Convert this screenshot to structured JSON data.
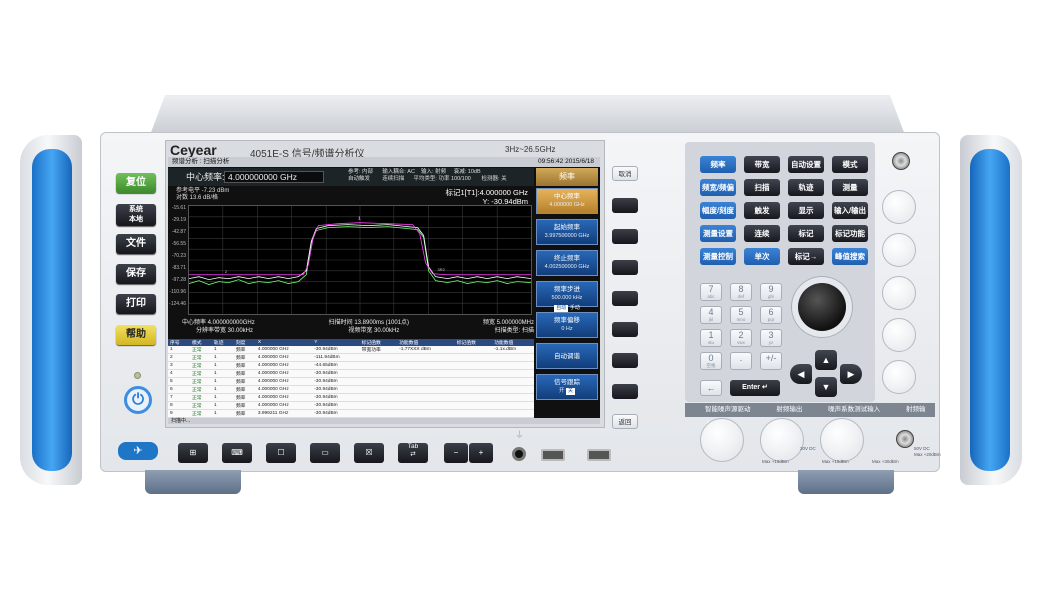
{
  "instrument": {
    "brand": "Ceyear",
    "model_title": "4051E-S 信号/频谱分析仪",
    "freq_range": "3Hz~26.5GHz"
  },
  "screen": {
    "status_bar": "频谱分析 : 扫描分析",
    "status_time": "09:56:42  2015/6/18",
    "center_label": "中心频率:",
    "center_value": "4.000000000 GHz",
    "center_params": "参考: 内部      输入耦合: AC    输入: 射频     衰减: 10dB\n自动触发        连续扫描      平均类型: 功率 100/100       检测器: 关",
    "ref_level": "参考电平 -7.23 dBm",
    "scale": "对数 13.6 dB/格",
    "marker_label": "标记1[T1]:4.000000 GHz",
    "marker_value": "Y: -30.94dBm",
    "y_ticks": [
      "-15.61",
      "-29.19",
      "-42.87",
      "-56.55",
      "-70.23",
      "-83.71",
      "-97.28",
      "-110.96",
      "-124.46"
    ],
    "center_freq_footer": "中心频率 4.000000000GHz",
    "sweep_time": "扫描时间 13.8900ms (1001点)",
    "span": "频宽 5.000000MHz",
    "rbw": "分辨率带宽 30.00kHz",
    "vbw": "视频带宽 30.00kHz",
    "sweep_type": "扫描类型: 扫描",
    "bottom_status": "扫描中..."
  },
  "table": {
    "headers": [
      "序号",
      "模式",
      "轨迹",
      "刻度",
      "X",
      "Y",
      "标记函数",
      "功能数值",
      "标记函数",
      "功能数值"
    ],
    "rows": [
      [
        "1",
        "正常",
        "1",
        "频率",
        "4.000000 GHz",
        "-30.94dBm",
        "带宽功率",
        "-1.77XXX dBm",
        "",
        "-1.1x.dBm"
      ],
      [
        "2",
        "正常",
        "1",
        "频率",
        "4.000000 GHz",
        "-111.94dBm",
        "",
        "",
        "",
        ""
      ],
      [
        "3",
        "正常",
        "1",
        "频率",
        "4.000000 GHz",
        "-44.65dBm",
        "",
        "",
        "",
        ""
      ],
      [
        "4",
        "正常",
        "1",
        "频率",
        "4.000000 GHz",
        "-30.94dBm",
        "",
        "",
        "",
        ""
      ],
      [
        "5",
        "正常",
        "1",
        "频率",
        "4.000000 GHz",
        "-30.94dBm",
        "",
        "",
        "",
        ""
      ],
      [
        "6",
        "正常",
        "1",
        "频率",
        "4.000000 GHz",
        "-30.94dBm",
        "",
        "",
        "",
        ""
      ],
      [
        "7",
        "正常",
        "1",
        "频率",
        "4.000000 GHz",
        "-30.94dBm",
        "",
        "",
        "",
        ""
      ],
      [
        "8",
        "正常",
        "1",
        "频率",
        "4.000000 GHz",
        "-30.94dBm",
        "",
        "",
        "",
        ""
      ],
      [
        "9",
        "正常",
        "1",
        "频率",
        "3.999211 GHz",
        "-30.94dBm",
        "",
        "",
        "",
        ""
      ],
      [
        "10",
        "正常",
        "1",
        "频率",
        "4.000000 GHz",
        "-30.94dBm",
        "",
        "",
        "",
        ""
      ],
      [
        "11",
        "正常",
        "1",
        "频率",
        "4.000000 GHz",
        "-30.94dBm",
        "",
        "",
        "",
        ""
      ],
      [
        "12",
        "正常",
        "1",
        "频率",
        "4.000000 GHz",
        "-30.94dBm",
        "",
        "",
        "",
        ""
      ]
    ]
  },
  "softkeys": {
    "title": "频率",
    "items": [
      {
        "label": "中心频率",
        "value": "4.000000 GHz"
      },
      {
        "label": "起始频率",
        "value": "3.997500000 GHz"
      },
      {
        "label": "终止频率",
        "value": "4.002500000 GHz"
      },
      {
        "label": "频率步进",
        "value": "500.000 kHz"
      },
      {
        "label": "频率偏移",
        "value": "0 Hz"
      },
      {
        "label": "自动调谐",
        "value": ""
      },
      {
        "label": "信号跟踪",
        "value": ""
      }
    ],
    "step_auto": "自动",
    "step_manual": "手动",
    "track_on": "开",
    "track_off": "关"
  },
  "left_keys": {
    "reset": "复位",
    "system": "系统\n本地",
    "file": "文件",
    "save": "保存",
    "print": "打印",
    "help": "帮助"
  },
  "right_keys": {
    "cancel": "取消",
    "back": "返回"
  },
  "bottom_keys": {
    "tab": "Tab",
    "minus": "−",
    "plus": "+"
  },
  "function_keys": [
    "频率",
    "带宽",
    "自动设置",
    "模式",
    "频宽/频偏",
    "扫描",
    "轨迹",
    "测量",
    "幅度/刻度",
    "触发",
    "显示",
    "输入/输出",
    "测量设置",
    "连续",
    "标记",
    "标记功能",
    "测量控制",
    "单次",
    "标记→",
    "峰值搜索"
  ],
  "numpad": [
    {
      "k": "7",
      "s": "abc"
    },
    {
      "k": "8",
      "s": "def"
    },
    {
      "k": "9",
      "s": "ghi"
    },
    {
      "k": "4",
      "s": "jkl"
    },
    {
      "k": "5",
      "s": "mno"
    },
    {
      "k": "6",
      "s": "pqr"
    },
    {
      "k": "1",
      "s": "stu"
    },
    {
      "k": "2",
      "s": "vwx"
    },
    {
      "k": "3",
      "s": "yz"
    },
    {
      "k": "0",
      "s": "空格"
    },
    {
      "k": ".",
      "s": ""
    },
    {
      "k": "+/-",
      "s": ""
    }
  ],
  "enter_label": "Enter",
  "connector_strip": [
    "智能噪声源驱动",
    "射频输出",
    "噪声系数测试输入",
    "射频输入"
  ],
  "connector_notes": {
    "n1": "Max +15dBm",
    "n2": "20V DC",
    "n3": "Max +15dBm",
    "n4": "Max +30dBm",
    "n5": "50V DC",
    "n6": "Max +20dBm"
  },
  "colors": {
    "accent_blue": "#1f76c7",
    "screen_bg": "#000000",
    "trace_white": "#ffffff",
    "trace_magenta": "#ff40ff",
    "trace_green": "#70ff70"
  }
}
